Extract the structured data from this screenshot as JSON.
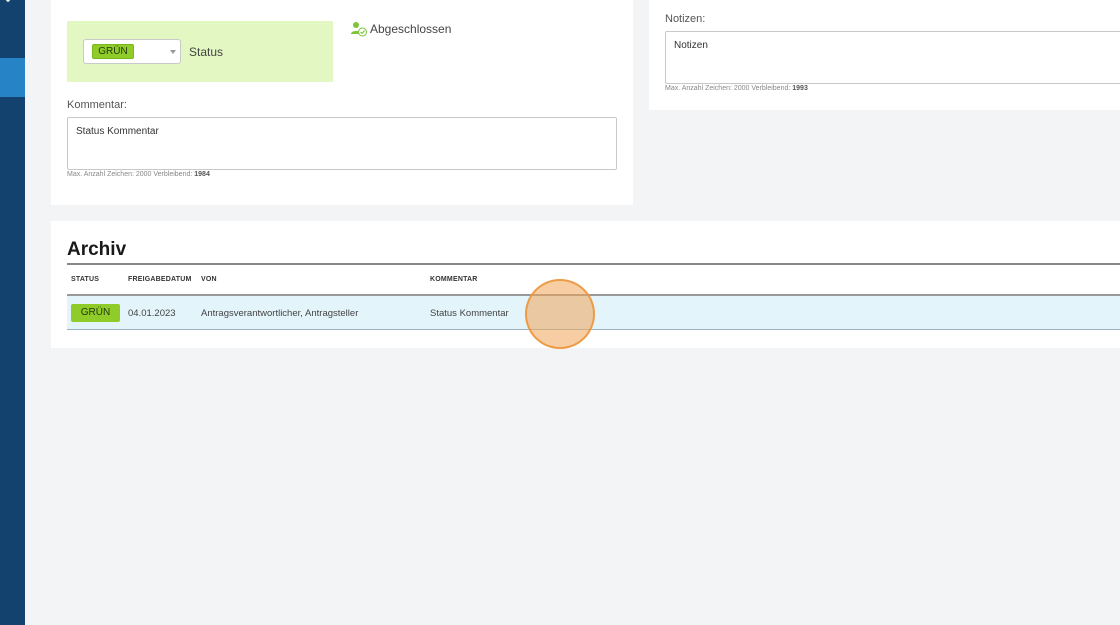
{
  "sidebar": {
    "collapse_icon": "chevron-down-icon"
  },
  "status_panel": {
    "selected_status": "GRÜN",
    "status_label": "Status",
    "completed_label": "Abgeschlossen",
    "completed_icon": "user-check-icon",
    "comment_label": "Kommentar:",
    "comment_value": "Status Kommentar",
    "comment_hint_prefix": "Max. Anzahl Zeichen: 2000 Verbleibend:",
    "comment_hint_remaining": "1984"
  },
  "notes_panel": {
    "label": "Notizen:",
    "value": "Notizen",
    "hint_prefix": "Max. Anzahl Zeichen: 2000 Verbleibend:",
    "hint_remaining": "1993"
  },
  "archiv": {
    "title": "Archiv",
    "columns": [
      "STATUS",
      "FREIGABEDATUM",
      "VON",
      "KOMMENTAR"
    ],
    "rows": [
      {
        "status": "GRÜN",
        "date": "04.01.2023",
        "from": "Antragsverantwortlicher, Antragsteller",
        "comment": "Status Kommentar"
      }
    ]
  },
  "colors": {
    "sidebar": "#12426d",
    "sidebar_active": "#2684c6",
    "status_green": "#8fcc2a",
    "status_box": "#e2f7c2",
    "row_highlight": "#e3f4fb"
  }
}
